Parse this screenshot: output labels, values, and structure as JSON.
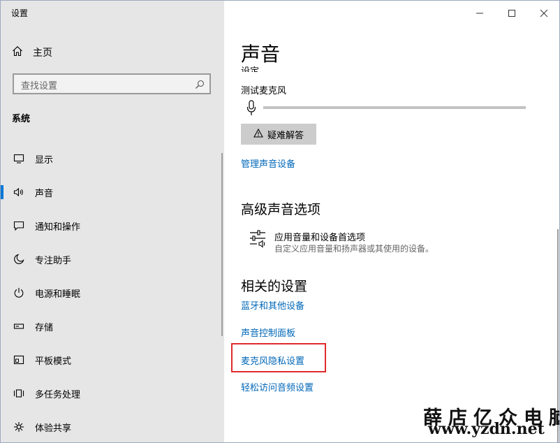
{
  "window": {
    "title": "设置"
  },
  "sidebar": {
    "home_label": "主页",
    "search_placeholder": "查找设置",
    "section_title": "系统",
    "items": [
      {
        "icon": "display-icon",
        "label": "显示"
      },
      {
        "icon": "speaker-icon",
        "label": "声音"
      },
      {
        "icon": "notification-icon",
        "label": "通知和操作"
      },
      {
        "icon": "moon-icon",
        "label": "专注助手"
      },
      {
        "icon": "power-icon",
        "label": "电源和睡眠"
      },
      {
        "icon": "storage-icon",
        "label": "存储"
      },
      {
        "icon": "tablet-icon",
        "label": "平板模式"
      },
      {
        "icon": "multitask-icon",
        "label": "多任务处理"
      },
      {
        "icon": "share-icon",
        "label": "体验共享"
      }
    ],
    "active_index": 1
  },
  "main": {
    "title": "声音",
    "clipped_text": "设定。",
    "mic_test_label": "测试麦克风",
    "troubleshoot_label": "疑难解答",
    "manage_devices_link": "管理声音设备",
    "advanced_heading": "高级声音选项",
    "advanced_item_title": "应用音量和设备首选项",
    "advanced_item_desc": "自定义应用音量和扬声器或其使用的设备。",
    "related_heading": "相关的设置",
    "links": [
      "蓝牙和其他设备",
      "声音控制面板",
      "麦克风隐私设置",
      "轻松访问音频设置"
    ]
  },
  "watermark": {
    "line1": "薛店亿众电脑",
    "line2": "www.yzdn.net"
  },
  "colors": {
    "accent": "#0078d7",
    "link": "#0067b8",
    "highlight": "#e12b2b",
    "sidebar_bg": "#e6e6e6"
  }
}
